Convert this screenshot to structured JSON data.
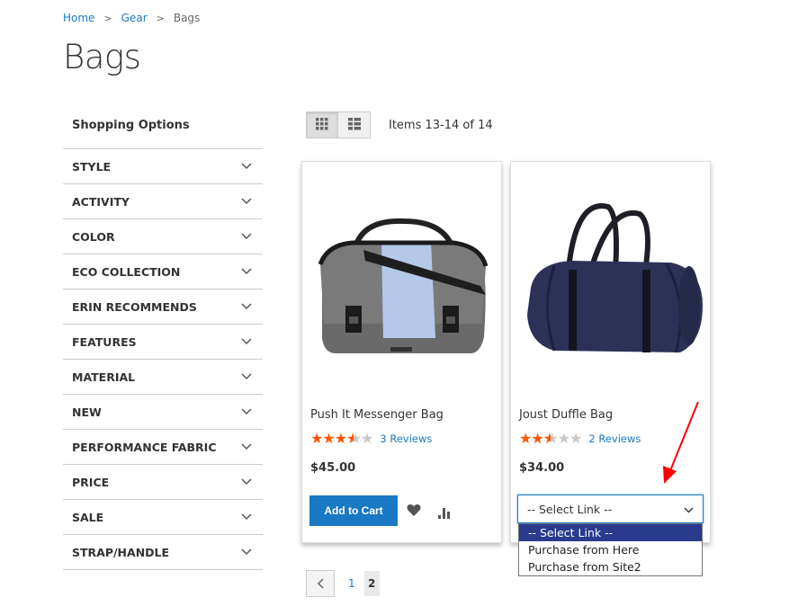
{
  "breadcrumb": {
    "home": "Home",
    "gear": "Gear",
    "current": "Bags",
    "separator": ">"
  },
  "page_title": "Bags",
  "sidebar": {
    "title": "Shopping Options",
    "filters": [
      "STYLE",
      "ACTIVITY",
      "COLOR",
      "ECO COLLECTION",
      "ERIN RECOMMENDS",
      "FEATURES",
      "MATERIAL",
      "NEW",
      "PERFORMANCE FABRIC",
      "PRICE",
      "SALE",
      "STRAP/HANDLE"
    ]
  },
  "toolbar": {
    "amount": "Items 13-14 of 14",
    "grid_icon": "grid-view-icon",
    "list_icon": "list-view-icon"
  },
  "products": [
    {
      "name": "Push It Messenger Bag",
      "rating_stars": 3.5,
      "reviews": "3  Reviews",
      "price": "$45.00",
      "add_to_cart": "Add to Cart"
    },
    {
      "name": "Joust Duffle Bag",
      "rating_stars": 2.5,
      "reviews": "2  Reviews",
      "price": "$34.00"
    }
  ],
  "select_link": {
    "value": "-- Select Link --",
    "options": [
      "-- Select Link --",
      "Purchase from Here",
      "Purchase from Site2"
    ]
  },
  "pager": {
    "page1": "1",
    "current": "2"
  },
  "colors": {
    "accent": "#1979c3",
    "star": "#ff5501",
    "annotation_arrow": "#ff0000",
    "selected_option": "#2a3a8c"
  }
}
